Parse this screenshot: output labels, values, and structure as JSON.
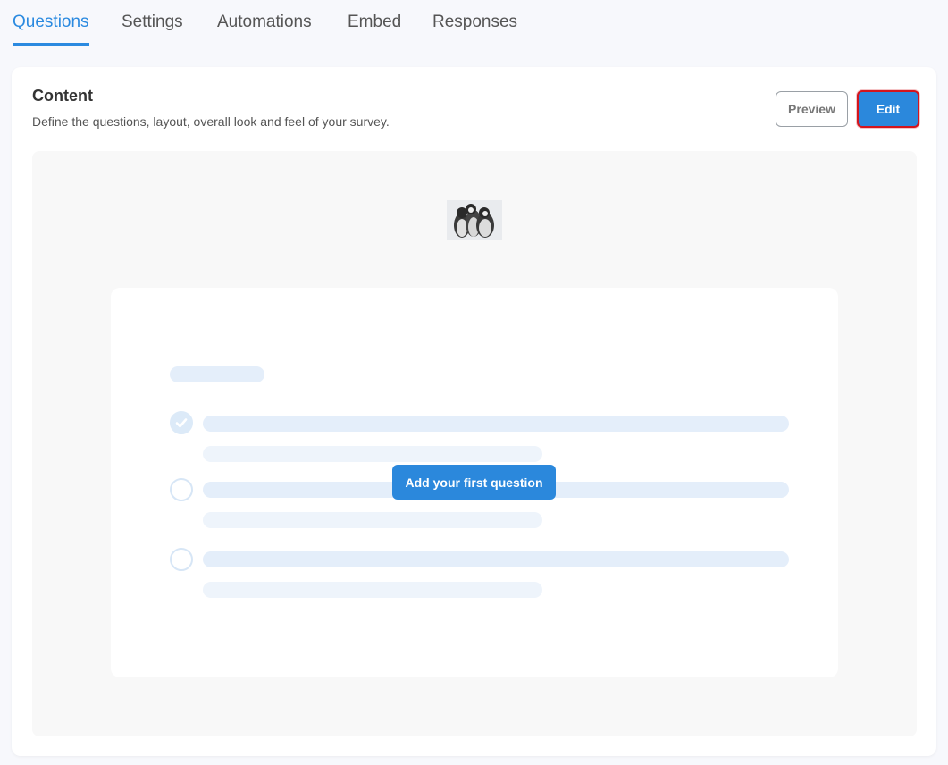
{
  "tabs": [
    {
      "label": "Questions",
      "active": true
    },
    {
      "label": "Settings",
      "active": false
    },
    {
      "label": "Automations",
      "active": false
    },
    {
      "label": "Embed",
      "active": false
    },
    {
      "label": "Responses",
      "active": false
    }
  ],
  "content": {
    "title": "Content",
    "description": "Define the questions, layout, overall look and feel of your survey.",
    "preview_label": "Preview",
    "edit_label": "Edit"
  },
  "empty_state": {
    "add_question_label": "Add your first question"
  },
  "colors": {
    "accent": "#2b88dc",
    "edit_highlight_border": "#d4141c",
    "background": "#f7f8fc"
  },
  "icons": [
    "penguins-logo-image",
    "check-circle-icon",
    "radio-circle-icon"
  ]
}
